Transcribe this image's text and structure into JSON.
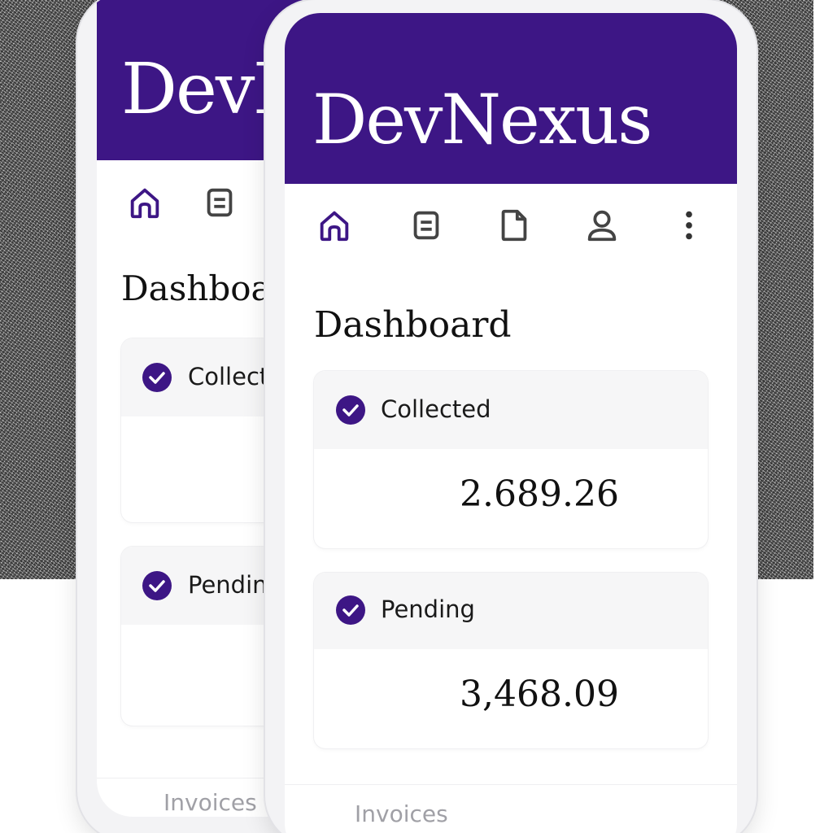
{
  "app": {
    "brand": "DevNexus",
    "accent": "#3d1685"
  },
  "nav": {
    "icons": [
      "home-icon",
      "list-icon",
      "document-icon",
      "user-icon",
      "more-icon"
    ]
  },
  "page": {
    "title": "Dashboard"
  },
  "cards": [
    {
      "label": "Collected",
      "value": "2.689.26"
    },
    {
      "label": "Pending",
      "value": "3,468.09"
    }
  ],
  "footer": {
    "tab_label": "Invoices"
  },
  "back_screen": {
    "brand": "DevN",
    "title": "Dashboar",
    "cards": [
      {
        "label": "Collect"
      },
      {
        "label": "Pendin"
      }
    ],
    "footer_label": "Invoices"
  }
}
